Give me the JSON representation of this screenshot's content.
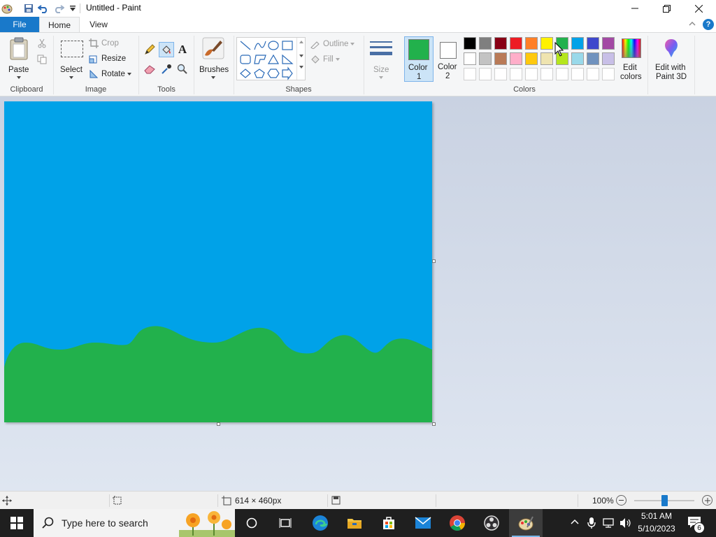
{
  "window": {
    "title": "Untitled - Paint",
    "quick_access": [
      "paint-app-icon",
      "save-icon",
      "undo-icon",
      "redo-icon",
      "customize-qat-icon"
    ]
  },
  "menu": {
    "file_label": "File",
    "tabs": [
      {
        "label": "Home",
        "active": true
      },
      {
        "label": "View",
        "active": false
      }
    ]
  },
  "ribbon": {
    "clipboard": {
      "paste_label": "Paste",
      "group_label": "Clipboard"
    },
    "image": {
      "select_label": "Select",
      "crop_label": "Crop",
      "resize_label": "Resize",
      "rotate_label": "Rotate",
      "group_label": "Image"
    },
    "tools": {
      "group_label": "Tools",
      "text_tool_glyph": "A"
    },
    "brushes": {
      "label": "Brushes"
    },
    "shapes": {
      "outline_label": "Outline",
      "fill_label": "Fill",
      "group_label": "Shapes"
    },
    "size": {
      "label": "Size"
    },
    "colors": {
      "color1_label": "Color",
      "color1_number": "1",
      "color2_label": "Color",
      "color2_number": "2",
      "color1_value": "#22b14c",
      "color2_value": "#ffffff",
      "edit_label_line1": "Edit",
      "edit_label_line2": "colors",
      "group_label": "Colors",
      "palette_row1": [
        "#000000",
        "#7f7f7f",
        "#880015",
        "#ed1c24",
        "#ff7f27",
        "#fff200",
        "#22b14c",
        "#00a2e8",
        "#3f48cc",
        "#a349a4"
      ],
      "palette_row2": [
        "#ffffff",
        "#c3c3c3",
        "#b97a57",
        "#ffaec9",
        "#ffc90e",
        "#efe4b0",
        "#b5e61d",
        "#99d9ea",
        "#7092be",
        "#c8bfe7"
      ]
    },
    "paint3d": {
      "label_line1": "Edit with",
      "label_line2": "Paint 3D"
    }
  },
  "canvas": {
    "sky_color": "#00a2e8",
    "ground_color": "#22b14c"
  },
  "status": {
    "dimensions": "614 × 460px",
    "zoom": "100%"
  },
  "taskbar": {
    "search_placeholder": "Type here to search",
    "time": "5:01 AM",
    "date": "5/10/2023",
    "notification_count": "6",
    "apps": [
      "cortana-icon",
      "task-view-icon",
      "edge-icon",
      "file-explorer-icon",
      "store-icon",
      "mail-icon",
      "chrome-icon",
      "obs-icon",
      "paint-icon"
    ]
  }
}
